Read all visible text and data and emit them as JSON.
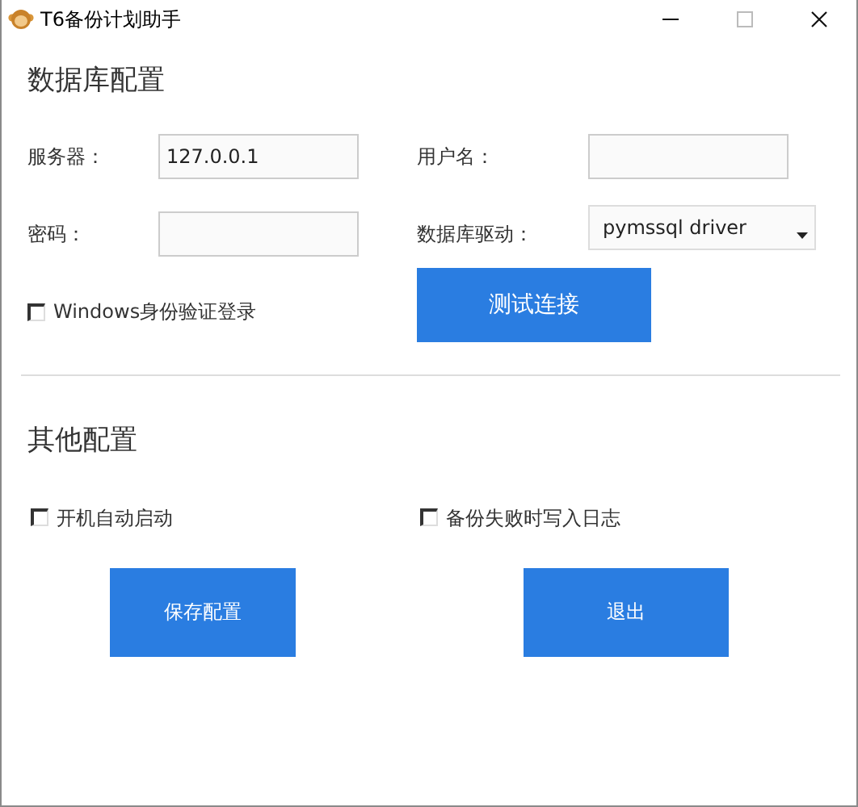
{
  "window": {
    "title": "T6备份计划助手"
  },
  "database_section": {
    "heading": "数据库配置",
    "fields": [
      {
        "label": "服务器：",
        "value": "127.0.0.1",
        "kind": "text"
      },
      {
        "label": "用户名：",
        "kind": "text"
      },
      {
        "label": "密码：",
        "kind": "password"
      },
      {
        "label": "数据库驱动：",
        "value": "pymssql driver",
        "kind": "select"
      }
    ],
    "checkbox": {
      "label": "Windows身份验证登录",
      "checked": false
    },
    "button": "测试连接"
  },
  "other_section": {
    "heading": "其他配置",
    "checkboxes": [
      {
        "label": "开机自动启动",
        "checked": false
      },
      {
        "label": "备份失败时写入日志",
        "checked": false
      }
    ],
    "buttons": [
      "保存配置",
      "退出"
    ]
  }
}
